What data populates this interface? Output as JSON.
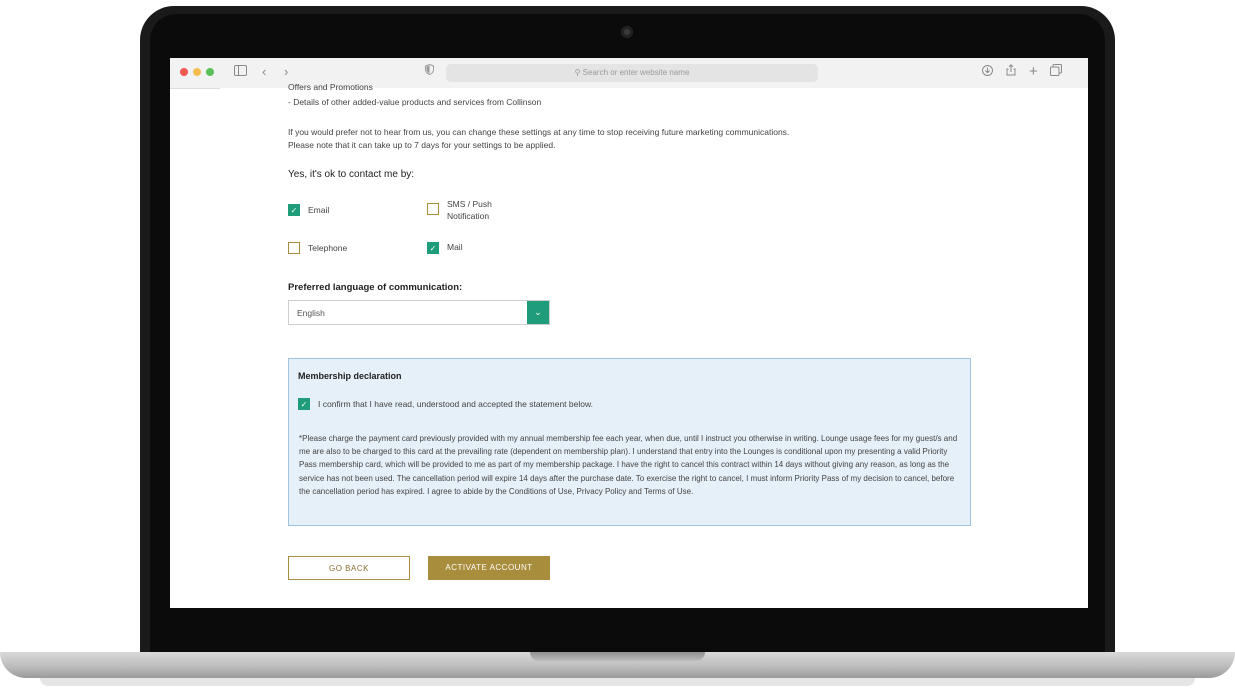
{
  "browser": {
    "search_placeholder": "Search or enter website name",
    "icons": [
      "sidebar-icon",
      "back-icon",
      "forward-icon",
      "privacy-shield-icon",
      "download-icon",
      "share-icon",
      "new-tab-icon",
      "tabs-overview-icon"
    ]
  },
  "page": {
    "clipped_line": "Offers and Promotions",
    "bullet_line": "- Details of other added-value products and services from Collinson",
    "opt_out_text": "If you would prefer not to hear from us, you can change these settings at any time to stop receiving future marketing communications. Please note that it can take up to 7 days for your settings to be applied.",
    "contact_heading": "Yes, it's ok to contact me by:",
    "contact_options": [
      {
        "label": "Email",
        "checked": true
      },
      {
        "label": "SMS / Push Notification",
        "checked": false
      },
      {
        "label": "Telephone",
        "checked": false
      },
      {
        "label": "Mail",
        "checked": true
      }
    ],
    "language_heading": "Preferred language of communication:",
    "language_value": "English",
    "declaration": {
      "title": "Membership declaration",
      "confirm_label": "I confirm that I have read, understood and accepted the statement below.",
      "confirm_checked": true,
      "statement": "*Please charge the payment card previously provided with my annual membership fee each year, when due, until I instruct you otherwise in writing. Lounge usage fees for my guest/s and me are also to be charged to this card at the prevailing rate (dependent on membership plan). I understand that entry into the Lounges is conditional upon my presenting a valid Priority Pass membership card, which will be provided to me as part of my membership package. I have the right to cancel this contract within 14 days without giving any reason, as long as the service has not been used. The cancellation period will expire 14 days after the purchase date. To exercise the right to cancel, I must inform Priority Pass of my decision to cancel, before the cancellation period has expired. I agree to abide by the Conditions of Use, Privacy Policy and Terms of Use."
    },
    "buttons": {
      "back": "GO BACK",
      "activate": "ACTIVATE ACCOUNT"
    }
  },
  "colors": {
    "accent_green": "#1f9d7a",
    "accent_gold": "#a88d3c",
    "declaration_bg": "#e6f0f8"
  }
}
